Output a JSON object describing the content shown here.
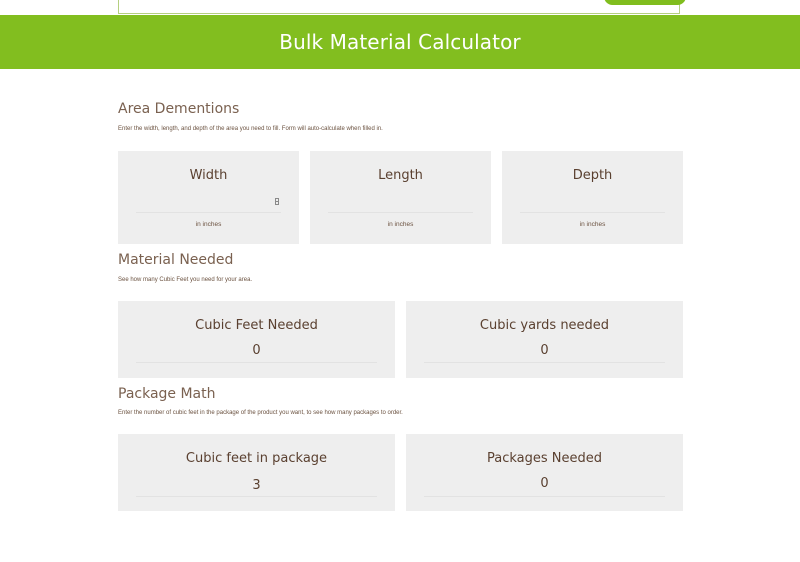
{
  "header": {
    "title": "Bulk Material Calculator"
  },
  "area": {
    "title": "Area Dementions",
    "description": "Enter the width, length, and depth of the area you need to fill. Form will auto-calculate when filled in.",
    "fields": [
      {
        "label": "Width",
        "unit": "in inches",
        "value": ""
      },
      {
        "label": "Length",
        "unit": "in inches",
        "value": ""
      },
      {
        "label": "Depth",
        "unit": "in inches",
        "value": ""
      }
    ]
  },
  "material": {
    "title": "Material Needed",
    "description": "See how many Cubic Feet you need for your area.",
    "fields": [
      {
        "label": "Cubic Feet Needed",
        "value": "0"
      },
      {
        "label": "Cubic yards needed",
        "value": "0"
      }
    ]
  },
  "package": {
    "title": "Package Math",
    "description": "Enter the number of cubic feet in the package of the product you want, to see how many packages to order.",
    "fields": [
      {
        "label": "Cubic feet in package",
        "value": "3"
      },
      {
        "label": "Packages Needed",
        "value": "0"
      }
    ]
  },
  "colors": {
    "accent": "#82be1f",
    "box_bg": "#eeeeee",
    "text": "#6b5240"
  }
}
